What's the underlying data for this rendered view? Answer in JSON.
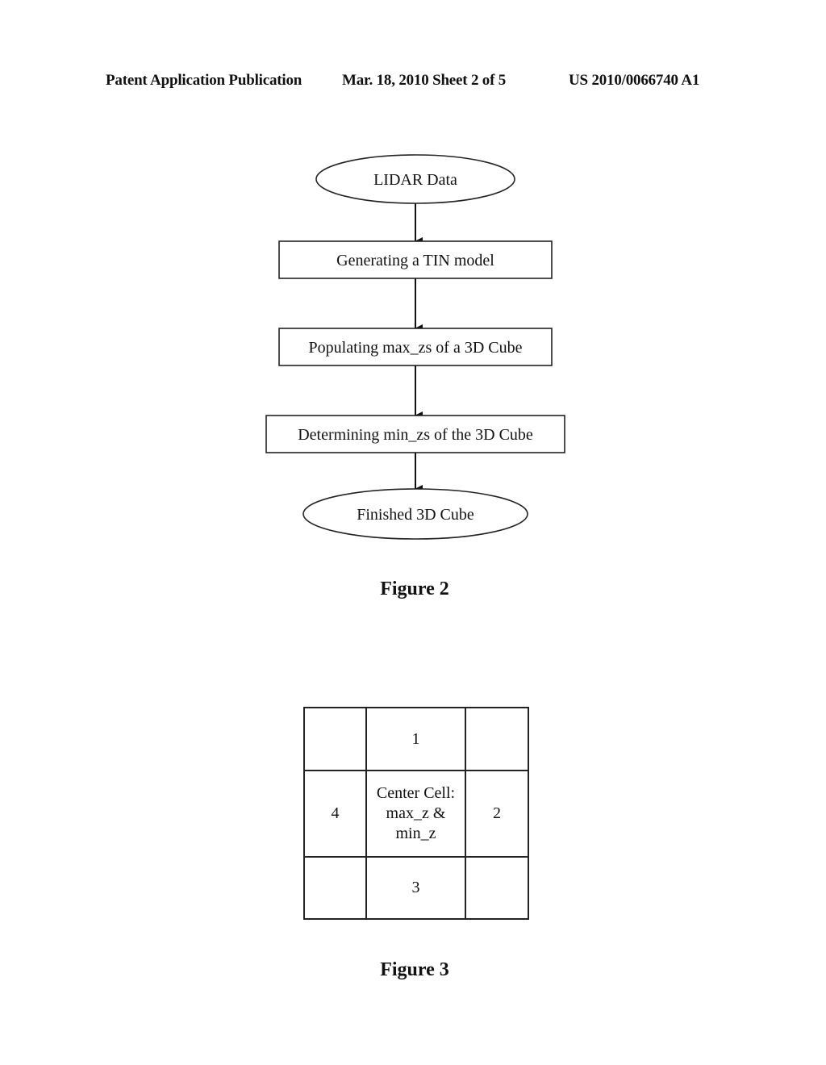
{
  "header": {
    "left": "Patent Application Publication",
    "center": "Mar. 18, 2010  Sheet 2 of 5",
    "right": "US 2010/0066740 A1"
  },
  "figure2": {
    "caption": "Figure 2",
    "nodes": [
      {
        "id": "lidar-data",
        "shape": "ellipse",
        "label": "LIDAR Data"
      },
      {
        "id": "generate-tin",
        "shape": "rect",
        "label": "Generating a TIN model"
      },
      {
        "id": "populate-max",
        "shape": "rect",
        "label": "Populating max_zs of a 3D Cube"
      },
      {
        "id": "determine-min",
        "shape": "rect",
        "label": "Determining min_zs of the 3D Cube"
      },
      {
        "id": "finished-cube",
        "shape": "ellipse",
        "label": "Finished 3D Cube"
      }
    ],
    "edges": [
      {
        "from": "lidar-data",
        "to": "generate-tin"
      },
      {
        "from": "generate-tin",
        "to": "populate-max"
      },
      {
        "from": "populate-max",
        "to": "determine-min"
      },
      {
        "from": "determine-min",
        "to": "finished-cube"
      }
    ]
  },
  "figure3": {
    "caption": "Figure 3",
    "cells": [
      [
        "",
        "1",
        ""
      ],
      [
        "4",
        "Center Cell:\nmax_z &\nmin_z",
        "2"
      ],
      [
        "",
        "3",
        ""
      ]
    ]
  }
}
